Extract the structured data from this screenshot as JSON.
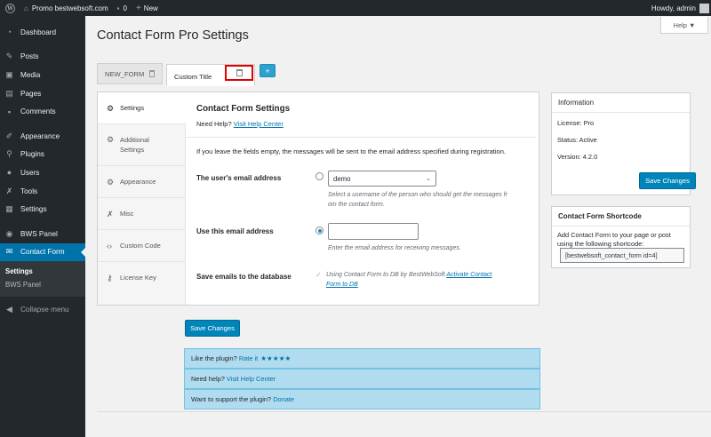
{
  "admin_bar": {
    "site_name": "Promo bestwebsoft.com",
    "comments_count": "0",
    "new_label": "New",
    "howdy": "Howdy, admin"
  },
  "sidebar": {
    "items": [
      {
        "label": "Dashboard",
        "icon": "dashboard-icon"
      },
      {
        "label": "Posts",
        "icon": "pin-icon"
      },
      {
        "label": "Media",
        "icon": "media-icon"
      },
      {
        "label": "Pages",
        "icon": "page-icon"
      },
      {
        "label": "Comments",
        "icon": "comment-icon"
      },
      {
        "label": "Appearance",
        "icon": "brush-icon"
      },
      {
        "label": "Plugins",
        "icon": "plugin-icon"
      },
      {
        "label": "Users",
        "icon": "user-icon"
      },
      {
        "label": "Tools",
        "icon": "wrench-icon"
      },
      {
        "label": "Settings",
        "icon": "settings-icon"
      },
      {
        "label": "BWS Panel",
        "icon": "bws-icon"
      },
      {
        "label": "Contact Form",
        "icon": "mail-icon"
      }
    ],
    "submenu": [
      "Settings",
      "BWS Panel"
    ],
    "collapse": "Collapse menu"
  },
  "header": {
    "title": "Contact Form Pro Settings",
    "help": "Help ▼"
  },
  "form_tabs": {
    "tab1": "NEW_FORM",
    "tab2": "Custom Title",
    "add": "+"
  },
  "vtabs": [
    {
      "label": "Settings",
      "icon": "gear-icon"
    },
    {
      "label": "Additional Settings",
      "icon": "gear-icon"
    },
    {
      "label": "Appearance",
      "icon": "gear-icon"
    },
    {
      "label": "Misc",
      "icon": "wrench-icon"
    },
    {
      "label": "Custom Code",
      "icon": "code-icon"
    },
    {
      "label": "License Key",
      "icon": "key-icon"
    }
  ],
  "content": {
    "title": "Contact Form Settings",
    "need_help": "Need Help?",
    "help_link": "Visit Help Center",
    "intro": "If you leave the fields empty, the messages will be sent to the email address specified during registration.",
    "users_email_label": "The user's email address",
    "select_value": "demo",
    "select_hint_1": "Select a username of the person who should get the messages fr",
    "select_hint_2": "om the contact form.",
    "use_email_label": "Use this email address",
    "email_value": "",
    "email_hint": "Enter the email address for receiving messages.",
    "save_db_label": "Save emails to the database",
    "db_text": "Using Contact Form to DB by BestWebSoft",
    "db_link_1": "Activate Contact",
    "db_link_2": "Form to DB"
  },
  "save_button": "Save Changes",
  "info_box": {
    "title": "Information",
    "license": "License: Pro",
    "status": "Status: Active",
    "version": "Version: 4.2.0",
    "save": "Save Changes"
  },
  "shortcode_box": {
    "title": "Contact Form Shortcode",
    "desc": "Add Contact Form to your page or post using the following shortcode:",
    "shortcode": "[bestwebsoft_contact_form id=4]"
  },
  "notices": {
    "rate_text": "Like the plugin?",
    "rate_link": "Rate it",
    "stars": "★★★★★",
    "help_text": "Need help?",
    "help_link": "Visit Help Center",
    "support_text": "Want to support the plugin?",
    "support_link": "Donate"
  },
  "colors": {
    "accent": "#0073aa",
    "admin_bar": "#23282d",
    "highlight_box": "#e00000",
    "notice_bg": "#b1dcf0"
  }
}
